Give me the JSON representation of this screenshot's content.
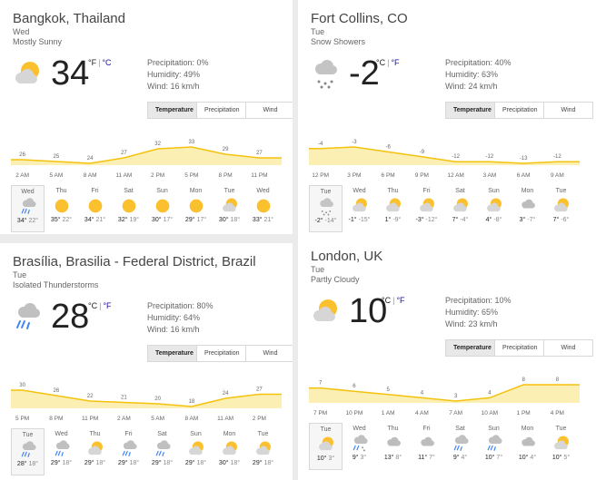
{
  "cards": [
    {
      "location": "Bangkok, Thailand",
      "day": "Wed",
      "condition": "Mostly Sunny",
      "icon": "sun-cloud-icon",
      "temp": "34",
      "unit_sel": "°F",
      "unit_sep": "|",
      "unit_other": "°C",
      "precip": "Precipitation: 0%",
      "humidity": "Humidity: 49%",
      "wind": "Wind: 16 km/h",
      "tabs": [
        "Temperature",
        "Precipitation",
        "Wind"
      ],
      "hourly_labels": [
        {
          "t": "2 AM",
          "v": 26
        },
        {
          "t": "5 AM",
          "v": 25
        },
        {
          "t": "8 AM",
          "v": 24
        },
        {
          "t": "11 AM",
          "v": 27
        },
        {
          "t": "2 PM",
          "v": 32
        },
        {
          "t": "5 PM",
          "v": 33
        },
        {
          "t": "8 PM",
          "v": 29
        },
        {
          "t": "11 PM",
          "v": 27
        }
      ],
      "forecast": [
        {
          "day": "Wed",
          "icon": "thunderstorm-icon",
          "hi": "34°",
          "lo": "22°"
        },
        {
          "day": "Thu",
          "icon": "sun-icon",
          "hi": "35°",
          "lo": "22°"
        },
        {
          "day": "Fri",
          "icon": "sun-icon",
          "hi": "34°",
          "lo": "21°"
        },
        {
          "day": "Sat",
          "icon": "sun-icon",
          "hi": "32°",
          "lo": "19°"
        },
        {
          "day": "Sun",
          "icon": "sun-icon",
          "hi": "30°",
          "lo": "17°"
        },
        {
          "day": "Mon",
          "icon": "sun-icon",
          "hi": "29°",
          "lo": "17°"
        },
        {
          "day": "Tue",
          "icon": "sun-cloud-icon",
          "hi": "30°",
          "lo": "18°"
        },
        {
          "day": "Wed",
          "icon": "sun-icon",
          "hi": "33°",
          "lo": "21°"
        }
      ]
    },
    {
      "location": "Fort Collins, CO",
      "day": "Tue",
      "condition": "Snow Showers",
      "icon": "snow-icon",
      "temp": "-2",
      "unit_sel": "°C",
      "unit_sep": "|",
      "unit_other": "°F",
      "precip": "Precipitation: 40%",
      "humidity": "Humidity: 63%",
      "wind": "Wind: 24 km/h",
      "tabs": [
        "Temperature",
        "Precipitation",
        "Wind"
      ],
      "hourly_labels": [
        {
          "t": "12 PM",
          "v": -4
        },
        {
          "t": "3 PM",
          "v": -3
        },
        {
          "t": "6 PM",
          "v": -6
        },
        {
          "t": "9 PM",
          "v": -9
        },
        {
          "t": "12 AM",
          "v": -12
        },
        {
          "t": "3 AM",
          "v": -12
        },
        {
          "t": "6 AM",
          "v": -13
        },
        {
          "t": "9 AM",
          "v": -12
        }
      ],
      "forecast": [
        {
          "day": "Tue",
          "icon": "snow-icon",
          "hi": "-2°",
          "lo": "-14°"
        },
        {
          "day": "Wed",
          "icon": "sun-cloud-icon",
          "hi": "-1°",
          "lo": "-15°"
        },
        {
          "day": "Thu",
          "icon": "sun-cloud-icon",
          "hi": "1°",
          "lo": "-9°"
        },
        {
          "day": "Fri",
          "icon": "sun-cloud-icon",
          "hi": "-3°",
          "lo": "-12°"
        },
        {
          "day": "Sat",
          "icon": "sun-cloud-icon",
          "hi": "7°",
          "lo": "-4°"
        },
        {
          "day": "Sun",
          "icon": "sun-cloud-icon",
          "hi": "4°",
          "lo": "-8°"
        },
        {
          "day": "Mon",
          "icon": "cloud-icon",
          "hi": "3°",
          "lo": "-7°"
        },
        {
          "day": "Tue",
          "icon": "sun-cloud-icon",
          "hi": "7°",
          "lo": "-6°"
        }
      ]
    },
    {
      "location": "Brasília, Brasilia - Federal District, Brazil",
      "day": "Tue",
      "condition": "Isolated Thunderstorms",
      "icon": "thunderstorm-icon",
      "temp": "28",
      "unit_sel": "°C",
      "unit_sep": "|",
      "unit_other": "°F",
      "precip": "Precipitation: 80%",
      "humidity": "Humidity: 64%",
      "wind": "Wind: 16 km/h",
      "tabs": [
        "Temperature",
        "Precipitation",
        "Wind"
      ],
      "hourly_labels": [
        {
          "t": "5 PM",
          "v": 30
        },
        {
          "t": "8 PM",
          "v": 26
        },
        {
          "t": "11 PM",
          "v": 22
        },
        {
          "t": "2 AM",
          "v": 21
        },
        {
          "t": "5 AM",
          "v": 20
        },
        {
          "t": "8 AM",
          "v": 18
        },
        {
          "t": "11 AM",
          "v": 24
        },
        {
          "t": "2 PM",
          "v": 27
        }
      ],
      "forecast": [
        {
          "day": "Tue",
          "icon": "thunderstorm-icon",
          "hi": "28°",
          "lo": "18°"
        },
        {
          "day": "Wed",
          "icon": "thunderstorm-icon",
          "hi": "29°",
          "lo": "18°"
        },
        {
          "day": "Thu",
          "icon": "sun-cloud-icon",
          "hi": "29°",
          "lo": "18°"
        },
        {
          "day": "Fri",
          "icon": "thunderstorm-icon",
          "hi": "29°",
          "lo": "18°"
        },
        {
          "day": "Sat",
          "icon": "thunderstorm-icon",
          "hi": "29°",
          "lo": "18°"
        },
        {
          "day": "Sun",
          "icon": "sun-cloud-icon",
          "hi": "29°",
          "lo": "18°"
        },
        {
          "day": "Mon",
          "icon": "sun-cloud-icon",
          "hi": "30°",
          "lo": "18°"
        },
        {
          "day": "Tue",
          "icon": "sun-cloud-icon",
          "hi": "29°",
          "lo": "18°"
        }
      ]
    },
    {
      "location": "London, UK",
      "day": "Tue",
      "condition": "Partly Cloudy",
      "icon": "sun-cloud-icon",
      "temp": "10",
      "unit_sel": "°C",
      "unit_sep": "|",
      "unit_other": "°F",
      "precip": "Precipitation: 10%",
      "humidity": "Humidity: 65%",
      "wind": "Wind: 23 km/h",
      "tabs": [
        "Temperature",
        "Precipitation",
        "Wind"
      ],
      "hourly_labels": [
        {
          "t": "7 PM",
          "v": 7
        },
        {
          "t": "10 PM",
          "v": 6
        },
        {
          "t": "1 AM",
          "v": 5
        },
        {
          "t": "4 AM",
          "v": 4
        },
        {
          "t": "7 AM",
          "v": 3
        },
        {
          "t": "10 AM",
          "v": 4
        },
        {
          "t": "1 PM",
          "v": 8
        },
        {
          "t": "4 PM",
          "v": 8
        }
      ],
      "forecast": [
        {
          "day": "Tue",
          "icon": "sun-cloud-icon",
          "hi": "10°",
          "lo": "3°"
        },
        {
          "day": "Wed",
          "icon": "snow-rain-icon",
          "hi": "9°",
          "lo": "3°"
        },
        {
          "day": "Thu",
          "icon": "cloud-icon",
          "hi": "13°",
          "lo": "8°"
        },
        {
          "day": "Fri",
          "icon": "cloud-icon",
          "hi": "11°",
          "lo": "7°"
        },
        {
          "day": "Sat",
          "icon": "rain-icon",
          "hi": "9°",
          "lo": "4°"
        },
        {
          "day": "Sun",
          "icon": "rain-icon",
          "hi": "10°",
          "lo": "7°"
        },
        {
          "day": "Mon",
          "icon": "cloud-icon",
          "hi": "10°",
          "lo": "4°"
        },
        {
          "day": "Tue",
          "icon": "sun-cloud-icon",
          "hi": "10°",
          "lo": "5°"
        }
      ]
    }
  ],
  "colors": {
    "chart_fill": "#fcefb4",
    "chart_line": "#f4c20d",
    "sun": "#fbc02d",
    "cloud": "#b0b0b0",
    "rain": "#4285f4"
  }
}
